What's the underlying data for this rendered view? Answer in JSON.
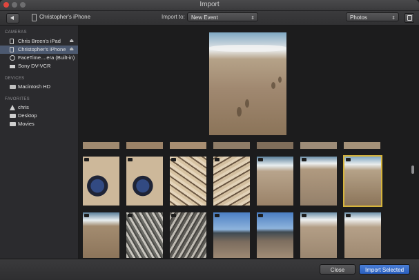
{
  "window": {
    "title": "Import"
  },
  "toolbar": {
    "device_title": "Christopher's iPhone",
    "import_to_label": "Import to:",
    "event_select_value": "New Event",
    "view_select_value": "Photos"
  },
  "sidebar": {
    "sections": [
      {
        "title": "CAMERAS",
        "items": [
          {
            "label": "Chris Breen's iPad",
            "icon": "tablet-icon",
            "eject": "⏏",
            "selected": false
          },
          {
            "label": "Christopher's iPhone",
            "icon": "phone-icon",
            "eject": "⏏",
            "selected": true
          },
          {
            "label": "FaceTime....era (Built-in)",
            "icon": "camera-icon",
            "eject": "",
            "selected": false
          },
          {
            "label": "Sony DV-VCR",
            "icon": "vcr-icon",
            "eject": "",
            "selected": false
          }
        ]
      },
      {
        "title": "DEVICES",
        "items": [
          {
            "label": "Macintosh HD",
            "icon": "hard-drive-icon",
            "eject": "",
            "selected": false
          }
        ]
      },
      {
        "title": "FAVORITES",
        "items": [
          {
            "label": "chris",
            "icon": "home-icon",
            "eject": "",
            "selected": false
          },
          {
            "label": "Desktop",
            "icon": "folder-icon",
            "eject": "",
            "selected": false
          },
          {
            "label": "Movies",
            "icon": "folder-icon",
            "eject": "",
            "selected": false
          }
        ]
      }
    ]
  },
  "footer": {
    "close_label": "Close",
    "import_selected_label": "Import Selected"
  },
  "colors": {
    "selection_highlight": "#4c5970",
    "selected_thumb_border": "#d6b43c",
    "primary_button": "#2a5fbe"
  }
}
